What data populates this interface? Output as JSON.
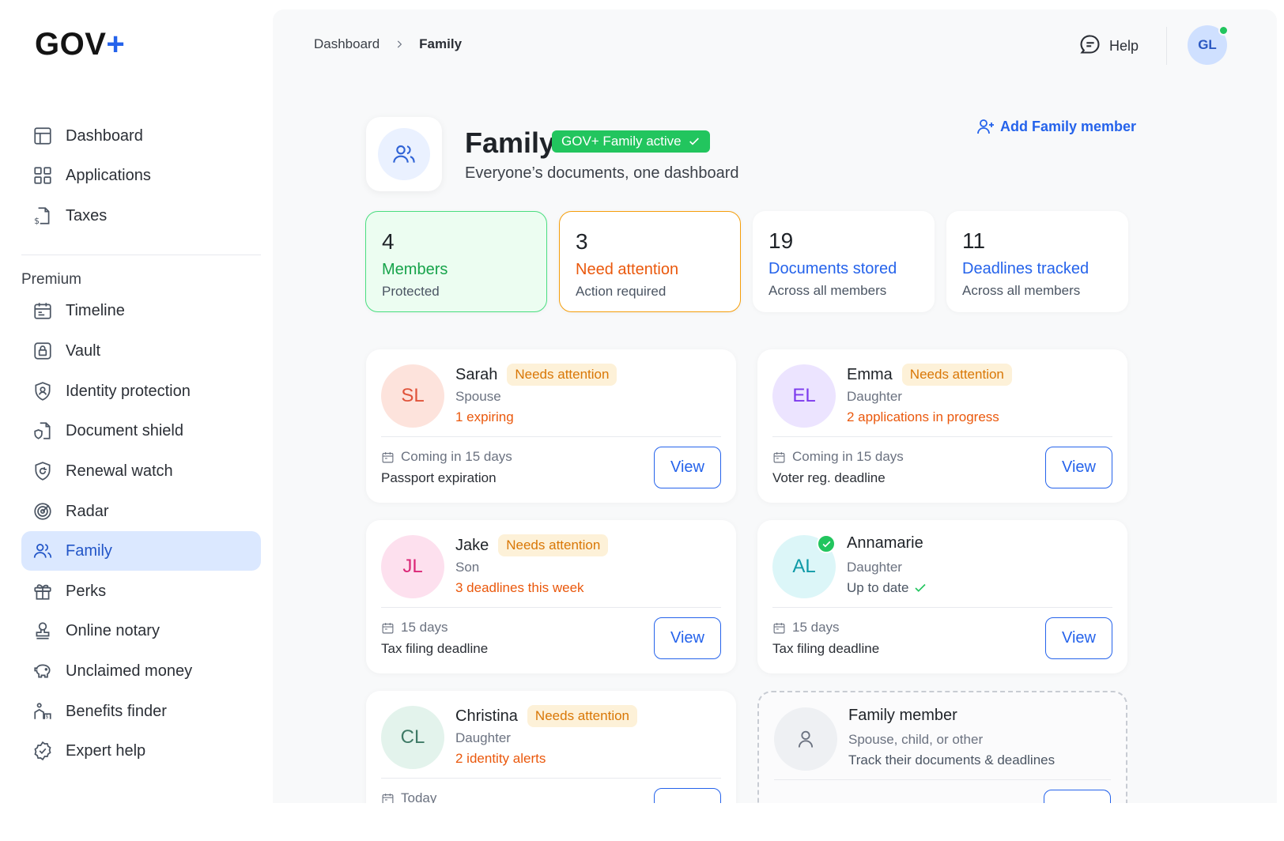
{
  "brand": {
    "name": "GOV",
    "plus": "+"
  },
  "sidebar": {
    "main_items": [
      {
        "label": "Dashboard",
        "icon": "layout-icon"
      },
      {
        "label": "Applications",
        "icon": "grid-icon"
      },
      {
        "label": "Taxes",
        "icon": "tax-document-icon"
      }
    ],
    "section_title": "Premium",
    "premium_items": [
      {
        "label": "Timeline",
        "icon": "calendar-icon"
      },
      {
        "label": "Vault",
        "icon": "lock-icon"
      },
      {
        "label": "Identity protection",
        "icon": "shield-user-icon"
      },
      {
        "label": "Document shield",
        "icon": "document-shield-icon"
      },
      {
        "label": "Renewal watch",
        "icon": "renewal-shield-icon"
      },
      {
        "label": "Radar",
        "icon": "radar-icon"
      },
      {
        "label": "Family",
        "icon": "users-icon",
        "active": true
      },
      {
        "label": "Perks",
        "icon": "gift-icon"
      },
      {
        "label": "Online notary",
        "icon": "stamp-icon"
      },
      {
        "label": "Unclaimed money",
        "icon": "piggy-bank-icon"
      },
      {
        "label": "Benefits finder",
        "icon": "benefits-icon"
      },
      {
        "label": "Expert help",
        "icon": "check-badge-icon"
      }
    ]
  },
  "topbar": {
    "breadcrumb": [
      "Dashboard",
      "Family"
    ],
    "help_label": "Help",
    "user_initials": "GL"
  },
  "family": {
    "title": "Family",
    "badge": "GOV+ Family active",
    "subtitle": "Everyone’s documents, one dashboard",
    "add_member_label": "Add Family member"
  },
  "stats": [
    {
      "number": "4",
      "label": "Members",
      "sub": "Protected"
    },
    {
      "number": "3",
      "label": "Need attention",
      "sub": "Action required"
    },
    {
      "number": "19",
      "label": "Documents stored",
      "sub": "Across all members"
    },
    {
      "number": "11",
      "label": "Deadlines tracked",
      "sub": "Across all members"
    }
  ],
  "members": [
    {
      "initials": "SL",
      "name": "Sarah",
      "tag": "Needs attention",
      "role": "Spouse",
      "status": "1 expiring",
      "due": "Coming in 15 days",
      "task": "Passport expiration",
      "view": "View"
    },
    {
      "initials": "EL",
      "name": "Emma",
      "tag": "Needs attention",
      "role": "Daughter",
      "status": "2 applications in progress",
      "due": "Coming in 15 days",
      "task": "Voter reg. deadline",
      "view": "View"
    },
    {
      "initials": "JL",
      "name": "Jake",
      "tag": "Needs attention",
      "role": "Son",
      "status": "3 deadlines this week",
      "due": "15 days",
      "task": "Tax filing deadline",
      "view": "View"
    },
    {
      "initials": "AL",
      "name": "Annamarie",
      "tag": "",
      "role": "Daughter",
      "status": "Up to date",
      "due": "15 days",
      "task": "Tax filing deadline",
      "view": "View"
    },
    {
      "initials": "CL",
      "name": "Christina",
      "tag": "Needs attention",
      "role": "Daughter",
      "status": "2 identity alerts",
      "due": "Today",
      "task": "",
      "view": ""
    }
  ],
  "placeholder_card": {
    "name": "Family member",
    "role": "Spouse, child, or other",
    "status": "Track their documents & deadlines"
  },
  "colors": {
    "accent": "#2563eb",
    "success": "#22c55e",
    "warning": "#ea580c",
    "active_nav_bg": "#dbe8ff"
  }
}
